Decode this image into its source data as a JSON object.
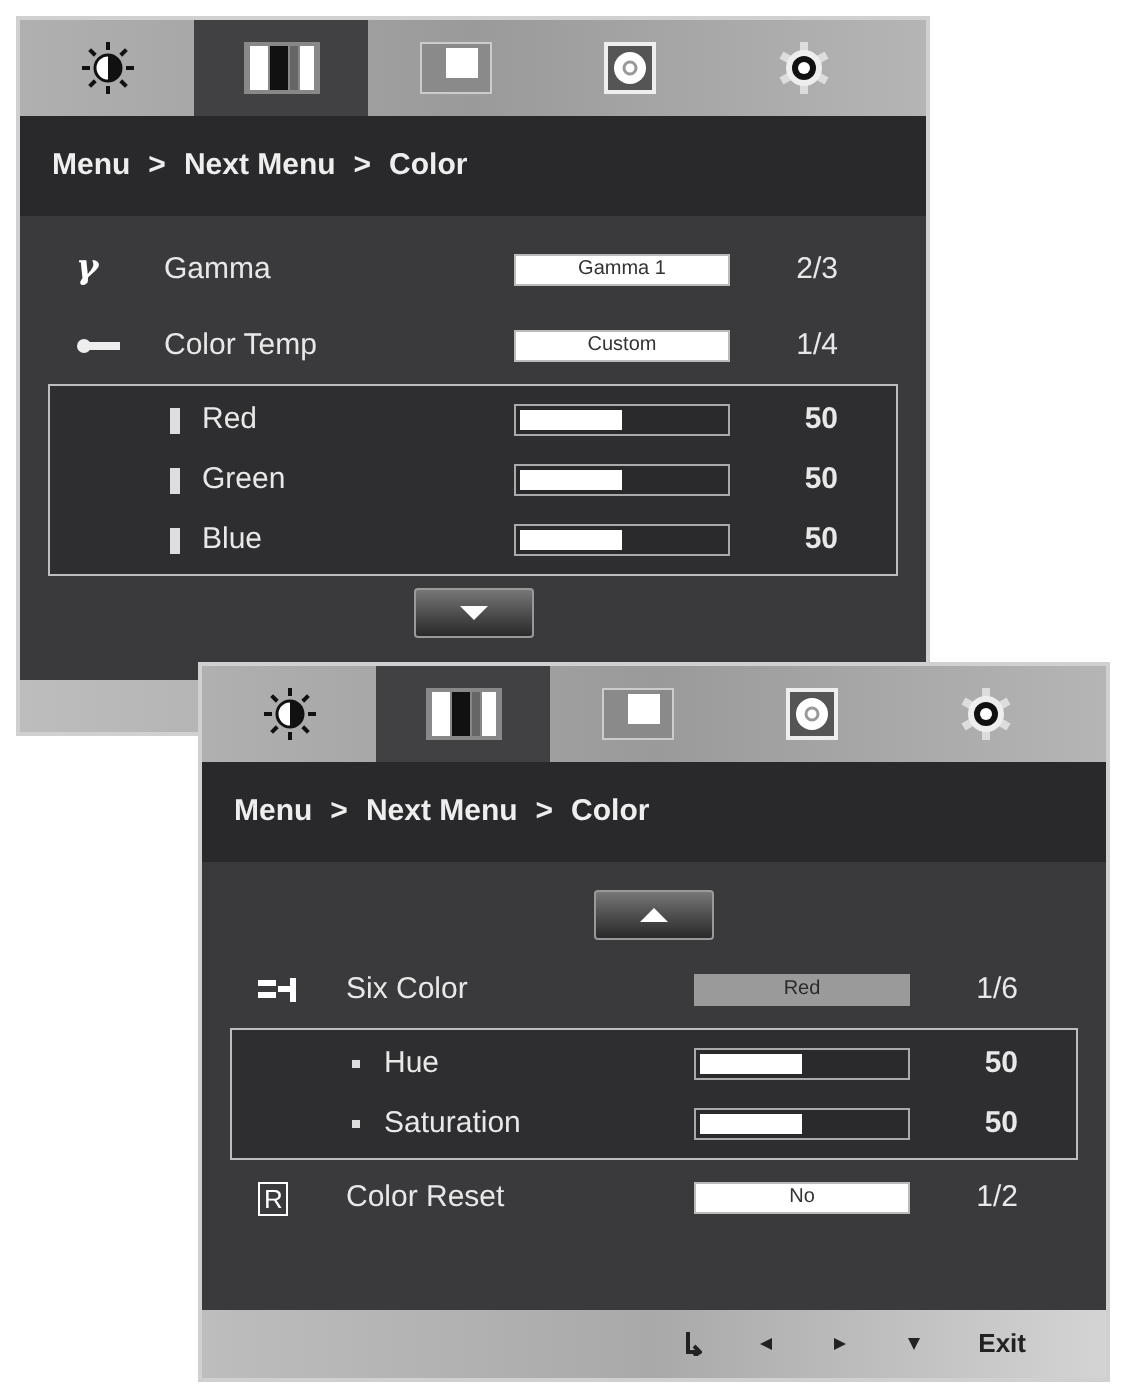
{
  "windows": [
    {
      "tabs": [
        {
          "kind": "brightness",
          "selected": false
        },
        {
          "kind": "color-bars",
          "selected": true
        },
        {
          "kind": "picture",
          "selected": false
        },
        {
          "kind": "disc",
          "selected": false
        },
        {
          "kind": "gear",
          "selected": false
        }
      ],
      "breadcrumb": [
        "Menu",
        ">",
        "Next Menu",
        ">",
        "Color"
      ],
      "body": [
        {
          "kind": "option",
          "icon": {
            "kind": "glyph",
            "text": "γ"
          },
          "label": "Gamma",
          "value": "Gamma 1",
          "focused": false,
          "index": "2/3"
        },
        {
          "kind": "option",
          "icon": {
            "kind": "temp"
          },
          "label": "Color Temp",
          "value": "Custom",
          "focused": false,
          "index": "1/4"
        },
        {
          "kind": "group",
          "items": [
            {
              "kind": "bar",
              "label": "Red",
              "level": 0.5,
              "reading": "50"
            },
            {
              "kind": "bar",
              "label": "Green",
              "level": 0.5,
              "reading": "50"
            },
            {
              "kind": "bar",
              "label": "Blue",
              "level": 0.5,
              "reading": "50"
            }
          ]
        },
        {
          "kind": "scroll-down"
        }
      ]
    },
    {
      "tabs": [
        {
          "kind": "brightness",
          "selected": false
        },
        {
          "kind": "color-bars",
          "selected": true
        },
        {
          "kind": "picture",
          "selected": false
        },
        {
          "kind": "disc",
          "selected": false
        },
        {
          "kind": "gear",
          "selected": false
        }
      ],
      "breadcrumb": [
        "Menu",
        ">",
        "Next Menu",
        ">",
        "Color"
      ],
      "body": [
        {
          "kind": "scroll-up"
        },
        {
          "kind": "option",
          "icon": {
            "kind": "six-color"
          },
          "label": "Six Color",
          "value": "Red",
          "focused": true,
          "index": "1/6"
        },
        {
          "kind": "group",
          "items": [
            {
              "kind": "dot",
              "label": "Hue",
              "level": 0.5,
              "reading": "50"
            },
            {
              "kind": "dot",
              "label": "Saturation",
              "level": 0.5,
              "reading": "50"
            }
          ]
        },
        {
          "kind": "option",
          "icon": {
            "kind": "boxed",
            "text": "R"
          },
          "label": "Color Reset",
          "value": "No",
          "focused": false,
          "index": "1/2"
        }
      ],
      "footer": [
        {
          "kind": "return"
        },
        {
          "kind": "left"
        },
        {
          "kind": "right"
        },
        {
          "kind": "down"
        },
        {
          "kind": "label",
          "label": "Exit"
        }
      ]
    }
  ]
}
